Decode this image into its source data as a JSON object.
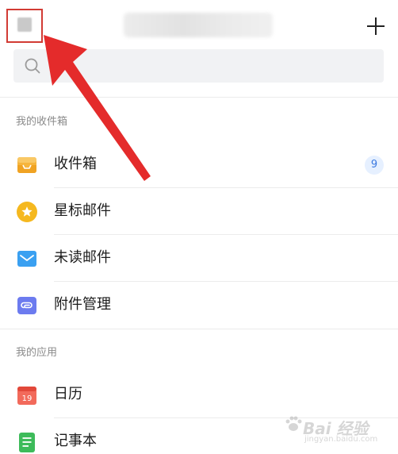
{
  "header": {
    "avatar_icon": "avatar-blurred",
    "account_name": "",
    "add_icon": "plus-icon"
  },
  "search": {
    "placeholder": "",
    "icon": "search-icon"
  },
  "sections": {
    "mailboxes": {
      "title": "我的收件箱",
      "items": [
        {
          "label": "收件箱",
          "icon": "inbox-icon",
          "badge": "9",
          "color": "#f6b53d"
        },
        {
          "label": "星标邮件",
          "icon": "star-icon",
          "color": "#f5b81f"
        },
        {
          "label": "未读邮件",
          "icon": "envelope-icon",
          "color": "#3aa0f1"
        },
        {
          "label": "附件管理",
          "icon": "attachment-icon",
          "color": "#6c7bef"
        }
      ]
    },
    "apps": {
      "title": "我的应用",
      "items": [
        {
          "label": "日历",
          "icon": "calendar-icon",
          "date": "19",
          "color": "#f26a5b"
        },
        {
          "label": "记事本",
          "icon": "notepad-icon",
          "color": "#3dbb5a"
        }
      ]
    }
  },
  "annotation": {
    "arrow_color": "#e42b2b",
    "highlight_color": "#d23b34"
  },
  "watermark": {
    "text": "Bai 经验",
    "sub": "jingyan.baidu.com"
  }
}
